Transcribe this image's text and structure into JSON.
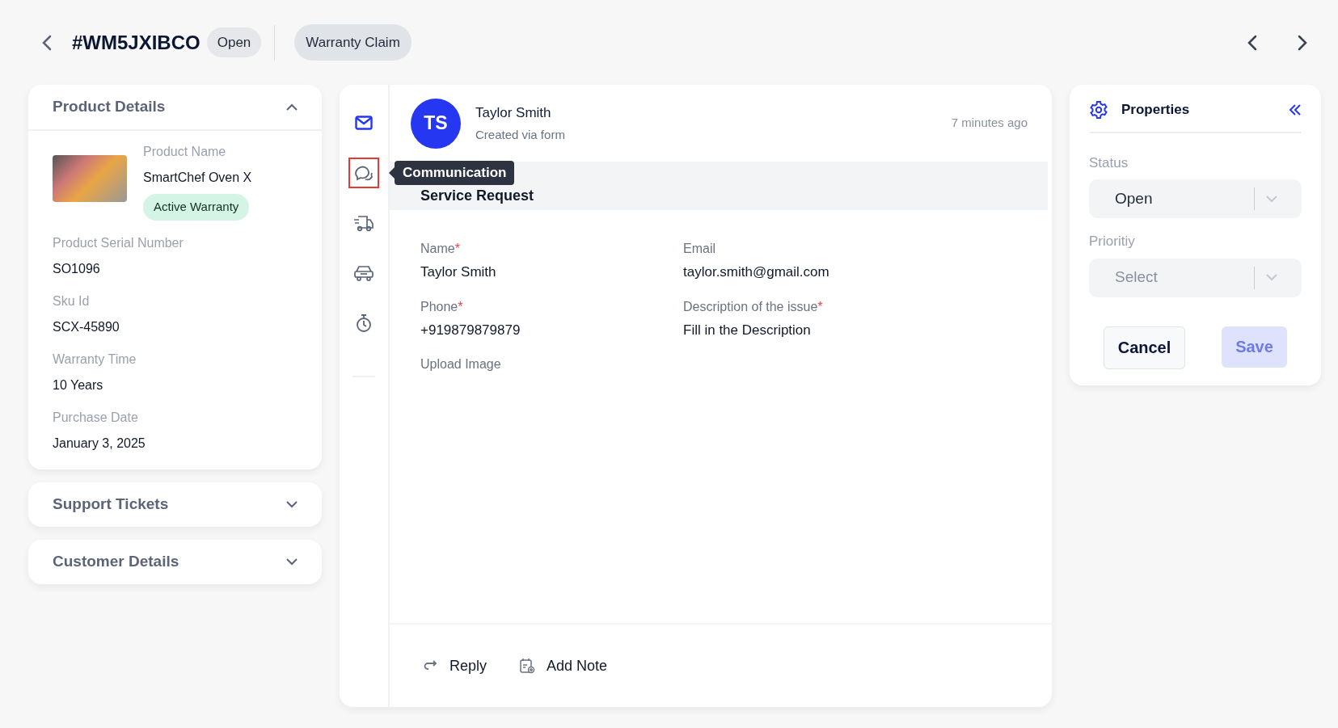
{
  "header": {
    "ticket_id": "#WM5JXIBCO",
    "status": "Open",
    "category": "Warranty Claim"
  },
  "accordions": [
    {
      "title": "Product Details",
      "expanded": true,
      "product": {
        "name_label": "Product Name",
        "name": "SmartChef Oven X",
        "badge": "Active Warranty"
      },
      "fields": [
        {
          "label": "Product Serial Number",
          "value": "SO1096"
        },
        {
          "label": "Sku Id",
          "value": "SCX-45890"
        },
        {
          "label": "Warranty Time",
          "value": "10 Years"
        },
        {
          "label": "Purchase Date",
          "value": "January 3, 2025"
        }
      ]
    },
    {
      "title": "Support Tickets",
      "expanded": false
    },
    {
      "title": "Customer Details",
      "expanded": false
    }
  ],
  "rail": [
    {
      "kind": "mail",
      "selected": false
    },
    {
      "kind": "chat",
      "selected": true,
      "tooltip": "Communication"
    },
    {
      "kind": "truck",
      "selected": false
    },
    {
      "kind": "car",
      "selected": false
    },
    {
      "kind": "timer",
      "selected": false
    }
  ],
  "ticket": {
    "avatar": "TS",
    "name": "Taylor Smith",
    "subtitle": "Created via form",
    "time": "7 minutes ago",
    "section_title": "Service Request",
    "fields": [
      {
        "label": "Name",
        "required_mark": "*",
        "value": "Taylor Smith"
      },
      {
        "label": "Email",
        "value": "taylor.smith@gmail.com"
      },
      {
        "label": "Phone",
        "required_mark": "*",
        "value": "+919879879879"
      },
      {
        "label": "Description of the issue",
        "required_mark": "*",
        "value": "Fill in the Description"
      },
      {
        "label": "Upload Image"
      }
    ],
    "actions": [
      {
        "kind": "reply",
        "label": "Reply"
      },
      {
        "kind": "note",
        "label": "Add Note"
      }
    ]
  },
  "properties": {
    "title": "Properties",
    "fields": [
      {
        "label": "Status",
        "value": "Open"
      },
      {
        "label": "Prioritiy",
        "placeholder": "Select"
      }
    ],
    "buttons": [
      {
        "label": "Cancel",
        "kind": "secondary",
        "disabled": false
      },
      {
        "label": "Save",
        "kind": "primary",
        "disabled": true
      }
    ]
  }
}
